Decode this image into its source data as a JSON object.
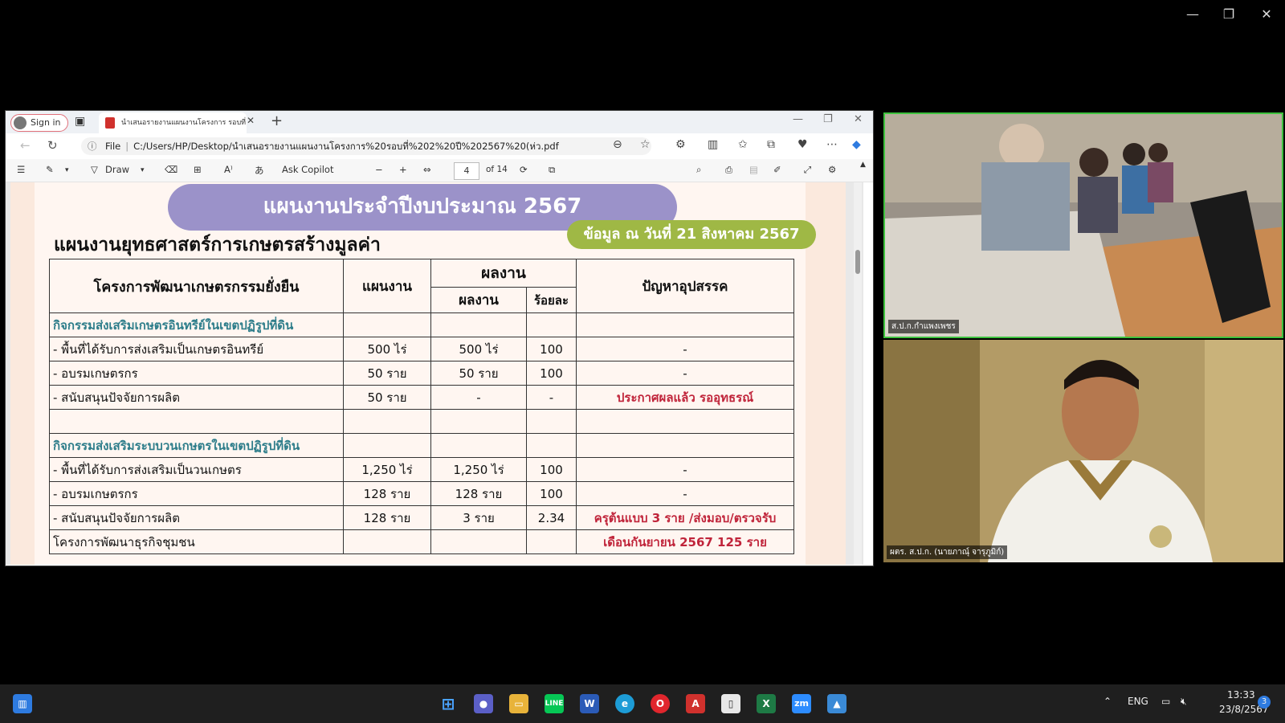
{
  "browser": {
    "sign_in": "Sign in",
    "tab_title": "นำเสนอรายงานแผนงานโครงการ รอบที่",
    "url_prefix": "File",
    "url": "C:/Users/HP/Desktop/นำเสนอรายงานแผนงานโครงการ%20รอบที่%202%20ปี%202567%20(ห่ว.pdf"
  },
  "pdf_toolbar": {
    "draw": "Draw",
    "ask_copilot": "Ask Copilot",
    "page_current": "4",
    "page_total": "of 14"
  },
  "document": {
    "banner": "แผนงานประจำปีงบประมาณ 2567",
    "date_badge": "ข้อมูล ณ วันที่ 21 สิงหาคม 2567",
    "title": "แผนงานยุทธศาสตร์การเกษตรสร้างมูลค่า",
    "table": {
      "h_project": "โครงการพัฒนาเกษตรกรรมยั่งยืน",
      "h_plan": "แผนงาน",
      "h_result_group": "ผลงาน",
      "h_result": "ผลงาน",
      "h_percent": "ร้อยละ",
      "h_problem": "ปัญหาอุปสรรค",
      "rows": [
        {
          "name": "กิจกรรมส่งเสริมเกษตรอินทรีย์ในเขตปฏิรูปที่ดิน",
          "plan": "",
          "result": "",
          "percent": "",
          "problem": ""
        },
        {
          "name": " - พื้นที่ได้รับการส่งเสริมเป็นเกษตรอินทรีย์",
          "plan": "500 ไร่",
          "result": "500 ไร่",
          "percent": "100",
          "problem": "-"
        },
        {
          "name": " - อบรมเกษตรกร",
          "plan": "50 ราย",
          "result": "50 ราย",
          "percent": "100",
          "problem": "-"
        },
        {
          "name": " - สนับสนุนปัจจัยการผลิต",
          "plan": "50 ราย",
          "result": "-",
          "percent": "-",
          "problem": "ประกาศผลแล้ว รออุทธรณ์"
        },
        {
          "name": "",
          "plan": "",
          "result": "",
          "percent": "",
          "problem": ""
        },
        {
          "name": "กิจกรรมส่งเสริมระบบวนเกษตรในเขตปฏิรูปที่ดิน",
          "plan": "",
          "result": "",
          "percent": "",
          "problem": ""
        },
        {
          "name": " - พื้นที่ได้รับการส่งเสริมเป็นวนเกษตร",
          "plan": "1,250 ไร่",
          "result": "1,250 ไร่",
          "percent": "100",
          "problem": "-"
        },
        {
          "name": " - อบรมเกษตรกร",
          "plan": "128 ราย",
          "result": "128 ราย",
          "percent": "100",
          "problem": "-"
        },
        {
          "name": " - สนับสนุนปัจจัยการผลิต",
          "plan": "128 ราย",
          "result": "3 ราย",
          "percent": "2.34",
          "problem": "ครุต้นแบบ 3 ราย /ส่งมอบ/ตรวจรับ"
        },
        {
          "name": "โครงการพัฒนาธุรกิจชุมชน",
          "plan": "",
          "result": "",
          "percent": "",
          "problem": "เดือนกันยายน 2567 125 ราย"
        }
      ]
    }
  },
  "video": {
    "tile1_label": "ส.ป.ก.กำแพงเพชร",
    "tile2_label": "ผตร. ส.ป.ก. (นายภาณุ์ จารุภูมิก์)"
  },
  "taskbar": {
    "lang": "ENG",
    "time": "13:33",
    "date": "23/8/2567",
    "badge": "3"
  }
}
